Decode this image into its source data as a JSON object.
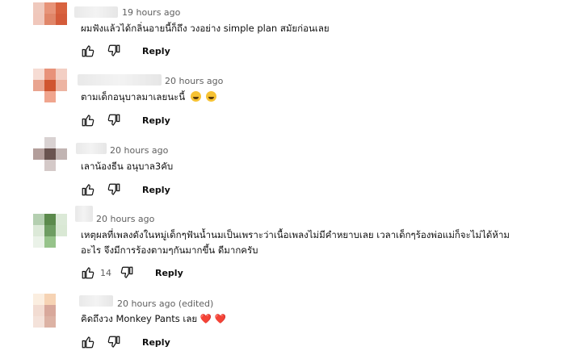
{
  "comments": [
    {
      "avatar": [
        "#efc9bd",
        "#e79378",
        "#d8623f",
        "#f0c7bb",
        "#e08669",
        "#d45b3a",
        "#ffffff",
        "#ffffff",
        "#ffffff"
      ],
      "meta": "19 hours ago",
      "text": "ผมฟังแล้วได้กลิ่นอายนี้ก็ถึง วงอย่าง simple plan สมัยก่อนเลย",
      "like_count": "",
      "reply": "Reply"
    },
    {
      "avatar": [
        "#f6dcd4",
        "#e8927a",
        "#f3cfc4",
        "#e9a48f",
        "#d05530",
        "#edb4a2",
        "#ffffff",
        "#f0a58e",
        "#ffffff"
      ],
      "meta": "20 hours ago",
      "text": "ตามเด็กอนุบาลมาเลยนะนี้",
      "like_count": "",
      "reply": "Reply"
    },
    {
      "avatar": [
        "#ffffff",
        "#d9d2d2",
        "#ffffff",
        "#b39e9b",
        "#6a5450",
        "#c1b4b2",
        "#ffffff",
        "#d4c9c8",
        "#ffffff"
      ],
      "meta": "20 hours ago",
      "text": "เลาน้องธีน อนุบาล3คับ",
      "like_count": "",
      "reply": "Reply"
    },
    {
      "avatar": [
        "#b4cfb0",
        "#5b8a4c",
        "#dbe9d7",
        "#dce9d8",
        "#6e9d62",
        "#d9e8d4",
        "#eaf2e8",
        "#96c38a",
        "#ffffff"
      ],
      "meta": "20 hours ago",
      "text_line1": "เหตุผลที่เพลงดังในหมู่เด็กๆฟันน้ำนมเป็นเพราะว่าเนื้อเพลงไม่มีคำหยาบเลย เวลาเด็กๆร้องพ่อแม่ก็จะไม่ได้ห้าม",
      "text_line2": "อะไร จึงมีการร้องตามๆกันมากขึ้น ดีมากครับ",
      "like_count": "14",
      "reply": "Reply"
    },
    {
      "avatar": [
        "#fbeee0",
        "#f6d3b4",
        "#ffffff",
        "#f2dcd2",
        "#d8a89b",
        "#ffffff",
        "#f4e2da",
        "#dcb2a4",
        "#ffffff"
      ],
      "meta": "20 hours ago (edited)",
      "text": "คิดถึงวง Monkey Pants เลย",
      "hearts": "❤️ ❤️",
      "like_count": "",
      "reply": "Reply"
    }
  ]
}
